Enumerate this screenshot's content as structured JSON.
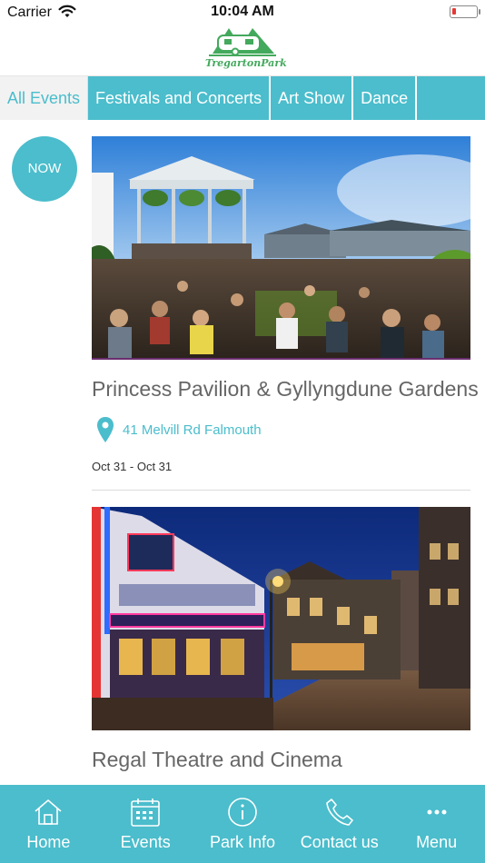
{
  "status_bar": {
    "carrier": "Carrier",
    "time": "10:04 AM"
  },
  "logo": {
    "text": "TregartonPark"
  },
  "tabs": [
    {
      "label": "All Events",
      "active": true
    },
    {
      "label": "Festivals and Concerts",
      "active": false
    },
    {
      "label": "Art Show",
      "active": false
    },
    {
      "label": "Dance",
      "active": false
    }
  ],
  "now_badge": "NOW",
  "events": [
    {
      "title": "Princess Pavilion & Gyllyngdune Gardens",
      "address": "41 Melvill Rd Falmouth",
      "dates": "Oct 31 - Oct 31"
    },
    {
      "title": "Regal Theatre and Cinema"
    }
  ],
  "bottom_nav": [
    {
      "label": "Home",
      "icon": "home-icon"
    },
    {
      "label": "Events",
      "icon": "calendar-icon"
    },
    {
      "label": "Park Info",
      "icon": "info-icon"
    },
    {
      "label": "Contact us",
      "icon": "phone-icon"
    },
    {
      "label": "Menu",
      "icon": "more-icon"
    }
  ],
  "colors": {
    "accent": "#4bbdcc",
    "logo_green": "#43a95c",
    "battery_low": "#e53935"
  }
}
